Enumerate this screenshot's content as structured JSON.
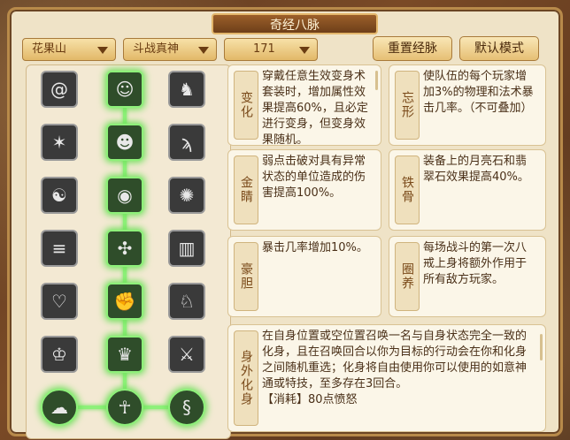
{
  "window": {
    "title": "奇经八脉"
  },
  "filters": {
    "school": "花果山",
    "branch": "斗战真神",
    "level": "171"
  },
  "buttons": {
    "reset": "重置经脉",
    "default": "默认模式"
  },
  "tree": {
    "rows": [
      {
        "left": {
          "icon": "swirl-icon",
          "active": false
        },
        "mid": {
          "icon": "monkey-face-icon",
          "active": true
        },
        "right": {
          "icon": "monkey-climb-icon",
          "active": false
        }
      },
      {
        "left": {
          "icon": "star-burst-icon",
          "active": false
        },
        "mid": {
          "icon": "pig-face-icon",
          "active": true
        },
        "right": {
          "icon": "claw-icon",
          "active": false
        }
      },
      {
        "left": {
          "icon": "head-profile-icon",
          "active": false
        },
        "mid": {
          "icon": "eye-icon",
          "active": true
        },
        "right": {
          "icon": "spiral-blade-icon",
          "active": false
        }
      },
      {
        "left": {
          "icon": "pedestal-icon",
          "active": false
        },
        "mid": {
          "icon": "whirlwind-icon",
          "active": true
        },
        "right": {
          "icon": "pillar-icon",
          "active": false
        }
      },
      {
        "left": {
          "icon": "heart-knot-icon",
          "active": false
        },
        "mid": {
          "icon": "fist-icon",
          "active": true
        },
        "right": {
          "icon": "rabbit-icon",
          "active": false
        }
      },
      {
        "left": {
          "icon": "warrior-head-icon",
          "active": false
        },
        "mid": {
          "icon": "monkey-fight-icon",
          "active": true
        },
        "right": {
          "icon": "sword-slash-icon",
          "active": false
        }
      }
    ],
    "bottom": [
      {
        "icon": "cloud-swirl-icon",
        "active": true
      },
      {
        "icon": "monk-seated-icon",
        "active": true
      },
      {
        "icon": "dragon-swirl-icon",
        "active": true
      }
    ]
  },
  "skills": [
    {
      "name": "变化",
      "desc": "穿戴任意生效变身术套装时，增加属性效果提高60%，且必定进行变身，但变身效果随机。"
    },
    {
      "name": "忘形",
      "desc": "使队伍的每个玩家增加3%的物理和法术暴击几率。（不可叠加）"
    },
    {
      "name": "金睛",
      "desc": "弱点击破对具有异常状态的单位造成的伤害提高100%。"
    },
    {
      "name": "铁骨",
      "desc": "装备上的月亮石和翡翠石效果提高40%。"
    },
    {
      "name": "豪胆",
      "desc": "暴击几率增加10%。"
    },
    {
      "name": "圈养",
      "desc": "每场战斗的第一次八戒上身将额外作用于所有敌方玩家。"
    },
    {
      "name": "身外化身",
      "desc": "在自身位置或空位置召唤一名与自身状态完全一致的化身，且在召唤回合以你为目标的行动会在你和化身之间随机重选；化身将自由使用你可以使用的如意神通或特技，至多存在3回合。",
      "cost": "【消耗】80点愤怒"
    }
  ]
}
